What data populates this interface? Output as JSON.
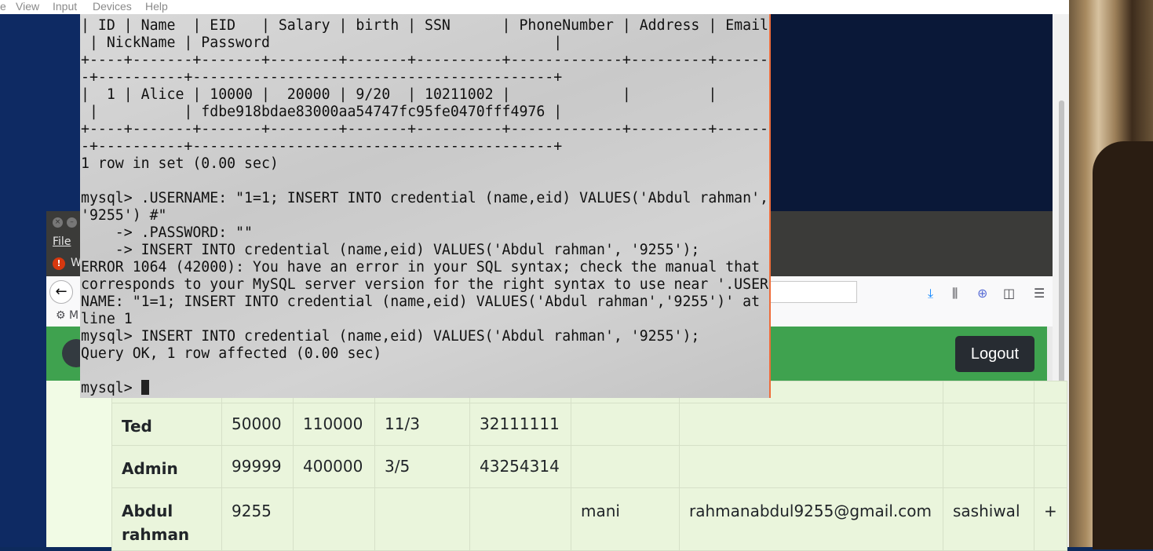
{
  "host_menu": [
    "e",
    "View",
    "Input",
    "Devices",
    "Help"
  ],
  "terminal": {
    "lines": [
      "| ID | Name  | EID   | Salary | birth | SSN      | PhoneNumber | Address | Email",
      " | NickName | Password                                 |",
      "+----+-------+-------+--------+-------+----------+-------------+---------+------",
      "-+----------+------------------------------------------+",
      "|  1 | Alice | 10000 |  20000 | 9/20  | 10211002 |             |         |",
      " |          | fdbe918bdae83000aa54747fc95fe0470fff4976 |",
      "+----+-------+-------+--------+-------+----------+-------------+---------+------",
      "-+----------+------------------------------------------+",
      "1 row in set (0.00 sec)",
      "",
      "mysql> .USERNAME: \"1=1; INSERT INTO credential (name,eid) VALUES('Abdul rahman',",
      "'9255') #\"",
      "    -> .PASSWORD: \"\"",
      "    -> INSERT INTO credential (name,eid) VALUES('Abdul rahman', '9255');",
      "ERROR 1064 (42000): You have an error in your SQL syntax; check the manual that",
      "corresponds to your MySQL server version for the right syntax to use near '.USER",
      "NAME: \"1=1; INSERT INTO credential (name,eid) VALUES('Abdul rahman','9255')' at",
      "line 1",
      "mysql> INSERT INTO credential (name,eid) VALUES('Abdul rahman', '9255');",
      "Query OK, 1 row affected (0.00 sec)",
      "",
      "mysql> "
    ]
  },
  "browser": {
    "menu_file": "File",
    "warning_text": "W",
    "bookmark_text": "M",
    "logout_label": "Logout"
  },
  "table": {
    "rows": [
      [
        "Ted",
        "50000",
        "110000",
        "11/3",
        "32111111",
        "",
        "",
        "",
        ""
      ],
      [
        "Admin",
        "99999",
        "400000",
        "3/5",
        "43254314",
        "",
        "",
        "",
        ""
      ],
      [
        "Abdul rahman",
        "9255",
        "",
        "",
        "",
        "mani",
        "rahmanabdul9255@gmail.com",
        "sashiwal",
        "+"
      ]
    ]
  }
}
